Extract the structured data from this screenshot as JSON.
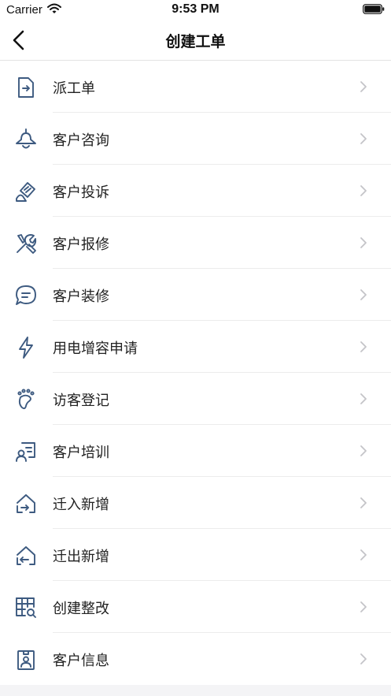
{
  "status_bar": {
    "carrier": "Carrier",
    "time": "9:53 PM"
  },
  "nav": {
    "title": "创建工单"
  },
  "colors": {
    "icon": "#3d5a80",
    "chevron": "#c4c4c8"
  },
  "menu": {
    "items": [
      {
        "label": "派工单",
        "icon": "file-arrow-icon"
      },
      {
        "label": "客户咨询",
        "icon": "bell-icon"
      },
      {
        "label": "客户投诉",
        "icon": "complaint-icon"
      },
      {
        "label": "客户报修",
        "icon": "tools-icon"
      },
      {
        "label": "客户装修",
        "icon": "chat-icon"
      },
      {
        "label": "用电增容申请",
        "icon": "lightning-icon"
      },
      {
        "label": "访客登记",
        "icon": "footprint-icon"
      },
      {
        "label": "客户培训",
        "icon": "training-icon"
      },
      {
        "label": "迁入新增",
        "icon": "move-in-icon"
      },
      {
        "label": "迁出新增",
        "icon": "move-out-icon"
      },
      {
        "label": "创建整改",
        "icon": "grid-search-icon"
      },
      {
        "label": "客户信息",
        "icon": "badge-icon"
      }
    ]
  }
}
